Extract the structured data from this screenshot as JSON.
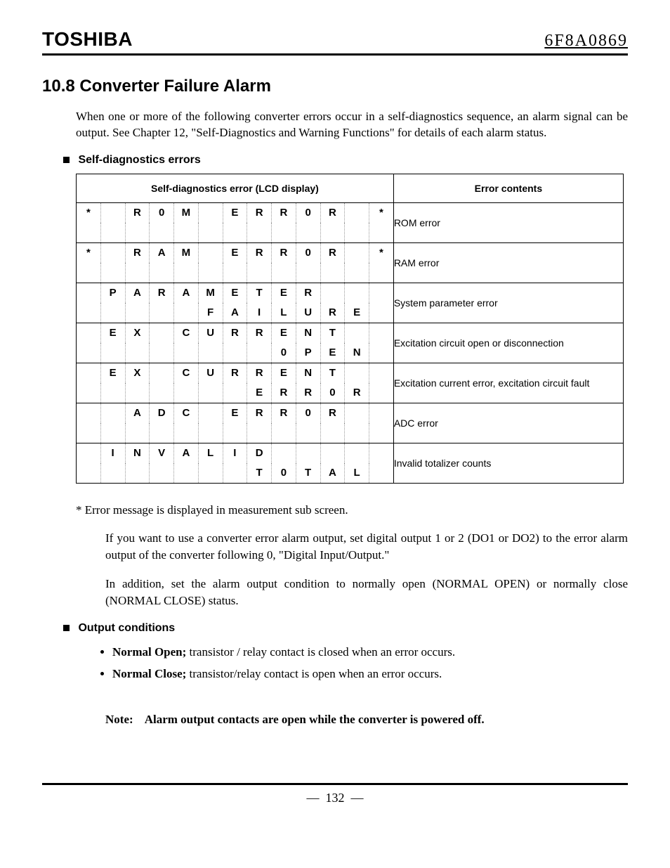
{
  "header": {
    "brand": "TOSHIBA",
    "docnum": "6F8A0869"
  },
  "section": {
    "number": "10.8",
    "title": "Converter Failure Alarm"
  },
  "intro": "When one or more of the following converter errors occur in a self-diagnostics sequence, an alarm signal can be output. See Chapter 12, \"Self-Diagnostics and Warning Functions\" for details of each alarm status.",
  "subhead_errors": "Self-diagnostics errors",
  "table": {
    "head_lcd": "Self-diagnostics error (LCD display)",
    "head_contents": "Error contents",
    "rows": [
      {
        "lcd": [
          [
            "*",
            "",
            "R",
            "0",
            "M",
            "",
            "E",
            "R",
            "R",
            "0",
            "R",
            "",
            "*"
          ],
          [
            "",
            "",
            "",
            "",
            "",
            "",
            "",
            "",
            "",
            "",
            "",
            "",
            ""
          ]
        ],
        "contents": "ROM error"
      },
      {
        "lcd": [
          [
            "*",
            "",
            "R",
            "A",
            "M",
            "",
            "E",
            "R",
            "R",
            "0",
            "R",
            "",
            "*"
          ],
          [
            "",
            "",
            "",
            "",
            "",
            "",
            "",
            "",
            "",
            "",
            "",
            "",
            ""
          ]
        ],
        "contents": "RAM error"
      },
      {
        "lcd": [
          [
            "",
            "P",
            "A",
            "R",
            "A",
            "M",
            "E",
            "T",
            "E",
            "R",
            "",
            "",
            ""
          ],
          [
            "",
            "",
            "",
            "",
            "",
            "F",
            "A",
            "I",
            "L",
            "U",
            "R",
            "E",
            ""
          ]
        ],
        "contents": "System parameter error"
      },
      {
        "lcd": [
          [
            "",
            "E",
            "X",
            "",
            "C",
            "U",
            "R",
            "R",
            "E",
            "N",
            "T",
            "",
            ""
          ],
          [
            "",
            "",
            "",
            "",
            "",
            "",
            "",
            "",
            "0",
            "P",
            "E",
            "N",
            ""
          ]
        ],
        "contents": "Excitation circuit open or disconnection"
      },
      {
        "lcd": [
          [
            "",
            "E",
            "X",
            "",
            "C",
            "U",
            "R",
            "R",
            "E",
            "N",
            "T",
            "",
            ""
          ],
          [
            "",
            "",
            "",
            "",
            "",
            "",
            "",
            "E",
            "R",
            "R",
            "0",
            "R",
            ""
          ]
        ],
        "contents": "Excitation current error, excitation circuit fault"
      },
      {
        "lcd": [
          [
            "",
            "",
            "A",
            "D",
            "C",
            "",
            "E",
            "R",
            "R",
            "0",
            "R",
            "",
            ""
          ],
          [
            "",
            "",
            "",
            "",
            "",
            "",
            "",
            "",
            "",
            "",
            "",
            "",
            ""
          ]
        ],
        "contents": "ADC error"
      },
      {
        "lcd": [
          [
            "",
            "I",
            "N",
            "V",
            "A",
            "L",
            "I",
            "D",
            "",
            "",
            "",
            "",
            ""
          ],
          [
            "",
            "",
            "",
            "",
            "",
            "",
            "",
            "T",
            "0",
            "T",
            "A",
            "L",
            ""
          ]
        ],
        "contents": "Invalid totalizer counts"
      }
    ]
  },
  "note_star": "* Error message is displayed in measurement sub screen.",
  "para1": "If you want to use a converter error alarm output, set digital output 1 or 2 (DO1 or DO2) to the error alarm output of the converter following 0, \"Digital Input/Output.\"",
  "para2": "In addition, set the alarm output condition to normally open (NORMAL OPEN) or normally close (NORMAL CLOSE) status.",
  "subhead_cond": "Output conditions",
  "cond": {
    "open_label": "Normal Open;",
    "open_text": " transistor / relay contact is closed when an error occurs.",
    "close_label": "Normal Close;",
    "close_text": " transistor/relay contact is open when an error occurs."
  },
  "note_bold_label": "Note:",
  "note_bold_text": "Alarm output contacts are open while the converter is powered off.",
  "page_number": "132"
}
